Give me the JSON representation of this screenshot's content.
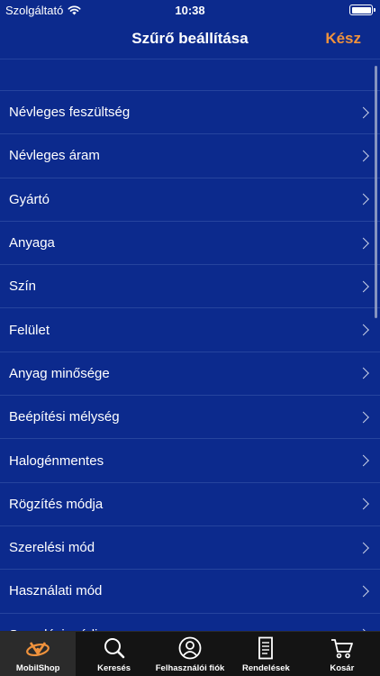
{
  "status_bar": {
    "carrier": "Szolgáltató",
    "time": "10:38"
  },
  "nav": {
    "title": "Szűrő beállítása",
    "done_label": "Kész"
  },
  "filters": [
    {
      "label": "Névleges feszültség"
    },
    {
      "label": "Névleges áram"
    },
    {
      "label": "Gyártó"
    },
    {
      "label": "Anyaga"
    },
    {
      "label": "Szín"
    },
    {
      "label": "Felület"
    },
    {
      "label": "Anyag minősége"
    },
    {
      "label": "Beépítési mélység"
    },
    {
      "label": "Halogénmentes"
    },
    {
      "label": "Rögzítés módja"
    },
    {
      "label": "Szerelési mód"
    },
    {
      "label": "Használati mód"
    },
    {
      "label": "Szerelési módja"
    }
  ],
  "tabs": [
    {
      "label": "MobilShop",
      "icon": "mobilshop-logo-icon",
      "active": true
    },
    {
      "label": "Keresés",
      "icon": "search-icon",
      "active": false
    },
    {
      "label": "Felhasználói fiók",
      "icon": "user-icon",
      "active": false
    },
    {
      "label": "Rendelések",
      "icon": "orders-icon",
      "active": false
    },
    {
      "label": "Kosár",
      "icon": "cart-icon",
      "active": false
    }
  ],
  "colors": {
    "background": "#0c2a8d",
    "accent": "#f0923c",
    "tab_bar": "#141414"
  }
}
